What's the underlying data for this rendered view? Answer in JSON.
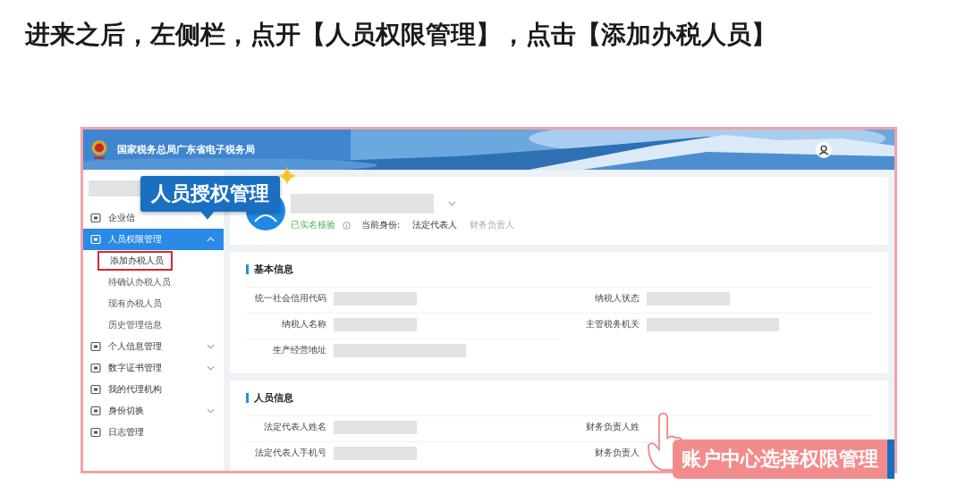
{
  "heading": "进来之后，左侧栏，点开【人员权限管理】，点击【添加办税人员】",
  "screenshot": {
    "header": {
      "title": "国家税务总局广东省电子税务局"
    },
    "sidebar": {
      "items": [
        {
          "label": "企业信",
          "kind": "link",
          "selected": false
        },
        {
          "label": "人员权限管理",
          "kind": "group",
          "selected": true,
          "expanded": true,
          "children": [
            {
              "label": "添加办税人员",
              "marked": true
            },
            {
              "label": "待确认办税人员",
              "marked": false
            },
            {
              "label": "现有办税人员",
              "marked": false
            },
            {
              "label": "历史管理信息",
              "marked": false
            }
          ]
        },
        {
          "label": "个人信息管理",
          "kind": "group",
          "selected": false,
          "expanded": false
        },
        {
          "label": "数字证书管理",
          "kind": "group",
          "selected": false,
          "expanded": false
        },
        {
          "label": "我的代理机构",
          "kind": "link",
          "selected": false
        },
        {
          "label": "身份切换",
          "kind": "group",
          "selected": false,
          "expanded": false
        },
        {
          "label": "日志管理",
          "kind": "link",
          "selected": false
        }
      ]
    },
    "profile": {
      "verified": "已实名核验",
      "identity_label": "当前身份:",
      "identities": [
        {
          "label": "法定代表人",
          "selected": true
        },
        {
          "label": "财务负责人",
          "selected": false
        }
      ]
    },
    "sections": [
      {
        "title": "基本信息",
        "fields": [
          {
            "label": "统一社会信用代码",
            "kind": "short"
          },
          {
            "label": "纳税人状态",
            "kind": "short"
          },
          {
            "label": "纳税人名称",
            "kind": "short"
          },
          {
            "label": "主管税务机关",
            "kind": "long"
          },
          {
            "label": "生产经营地址",
            "kind": "long"
          }
        ]
      },
      {
        "title": "人员信息",
        "fields": [
          {
            "label": "法定代表人姓名",
            "kind": "short"
          },
          {
            "label": "财务负责人姓",
            "kind": "covered"
          },
          {
            "label": "法定代表人手机号",
            "kind": "short"
          },
          {
            "label": "财务负责人",
            "kind": "covered"
          }
        ]
      }
    ]
  },
  "callout": "人员授权管理",
  "banner": "账户中心选择权限管理"
}
